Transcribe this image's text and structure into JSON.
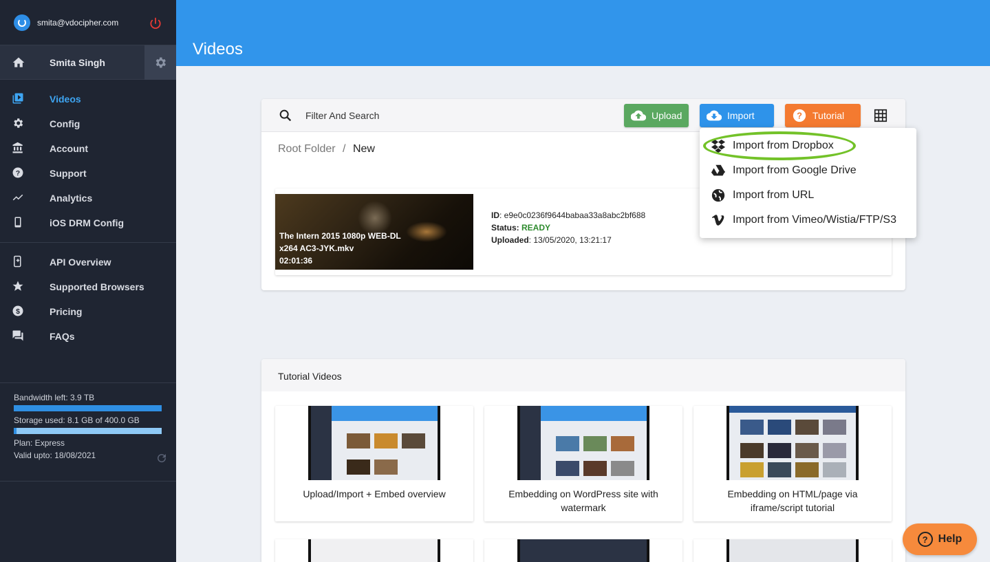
{
  "sidebar": {
    "email": "smita@vdocipher.com",
    "user_name": "Smita Singh",
    "groups": [
      [
        {
          "label": "Videos",
          "icon": "video-library-icon",
          "active": true
        },
        {
          "label": "Config",
          "icon": "gear-icon"
        },
        {
          "label": "Account",
          "icon": "bank-icon"
        },
        {
          "label": "Support",
          "icon": "help-icon"
        },
        {
          "label": "Analytics",
          "icon": "trending-icon"
        },
        {
          "label": "iOS DRM Config",
          "icon": "phone-icon"
        }
      ],
      [
        {
          "label": "API Overview",
          "icon": "api-icon"
        },
        {
          "label": "Supported Browsers",
          "icon": "star-icon"
        },
        {
          "label": "Pricing",
          "icon": "dollar-icon"
        },
        {
          "label": "FAQs",
          "icon": "forum-icon"
        }
      ]
    ],
    "stats": {
      "bandwidth": "Bandwidth left: 3.9 TB",
      "bandwidth_fraction": 1.0,
      "storage": "Storage used: 8.1 GB of 400.0 GB",
      "storage_fraction": 0.02,
      "plan": "Plan: Express",
      "valid": "Valid upto: 18/08/2021"
    }
  },
  "header": {
    "title": "Videos"
  },
  "toolbar": {
    "search_placeholder": "Filter And Search",
    "upload_label": "Upload",
    "import_label": "Import",
    "tutorial_label": "Tutorial"
  },
  "breadcrumb": {
    "root": "Root Folder",
    "separator": "/",
    "current": "New"
  },
  "video": {
    "title": "The Intern 2015 1080p WEB-DL x264 AC3-JYK.mkv",
    "duration": "02:01:36",
    "id_label": "ID",
    "id": ": e9e0c0236f9644babaa33a8abc2bf688",
    "status_label": "Status:",
    "status": "READY",
    "uploaded_label": "Uploaded",
    "uploaded": ": 13/05/2020, 13:21:17"
  },
  "import_menu": [
    {
      "label": "Import from Dropbox",
      "icon": "dropbox-icon"
    },
    {
      "label": "Import from Google Drive",
      "icon": "google-drive-icon"
    },
    {
      "label": "Import from URL",
      "icon": "globe-icon"
    },
    {
      "label": "Import from Vimeo/Wistia/FTP/S3",
      "icon": "vimeo-icon"
    }
  ],
  "tutorials": {
    "title": "Tutorial Videos",
    "items": [
      {
        "caption": "Upload/Import + Embed overview"
      },
      {
        "caption": "Embedding on WordPress site with watermark"
      },
      {
        "caption": "Embedding on HTML/page via iframe/script tutorial"
      }
    ]
  },
  "help": {
    "label": "Help"
  },
  "colors": {
    "header": "#3195eb",
    "sidebar": "#1f2532",
    "upload": "#5aa860",
    "import": "#2e93ea",
    "tutorial": "#f47a30",
    "highlight": "#73c229",
    "ready": "#2e8b2e"
  }
}
